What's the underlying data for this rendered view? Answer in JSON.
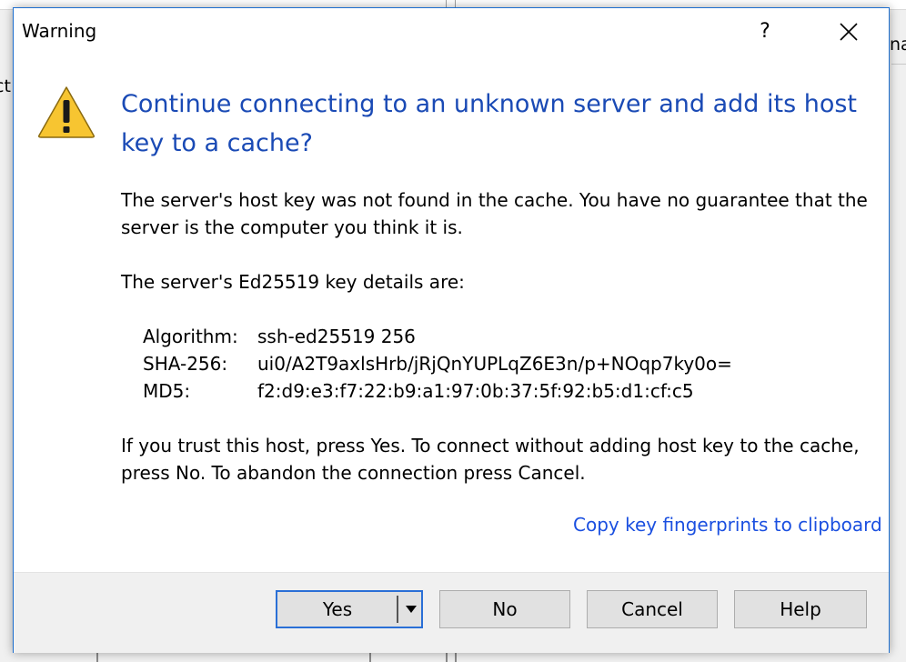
{
  "background": {
    "left_fragment": "ct",
    "right_fragment": "na"
  },
  "dialog": {
    "title": "Warning",
    "help_glyph": "?",
    "icons": {
      "warning": "warning-triangle-icon",
      "close": "close-icon",
      "dropdown": "triangle-down-icon"
    },
    "heading": "Continue connecting to an unknown server and add its host key to a cache?",
    "message1": "The server's host key was not found in the cache. You have no guarantee that the server is the computer you think it is.",
    "message2": "The server's Ed25519 key details are:",
    "details": [
      {
        "key": "Algorithm:",
        "value": "ssh-ed25519 256"
      },
      {
        "key": "SHA-256:",
        "value": "ui0/A2T9axlsHrb/jRjQnYUPLqZ6E3n/p+NOqp7ky0o="
      },
      {
        "key": "MD5:",
        "value": "f2:d9:e3:f7:22:b9:a1:97:0b:37:5f:92:b5:d1:cf:c5"
      }
    ],
    "message3": "If you trust this host, press Yes. To connect without adding host key to the cache, press No. To abandon the connection press Cancel.",
    "copy_link": "Copy key fingerprints to clipboard",
    "buttons": {
      "yes": "Yes",
      "no": "No",
      "cancel": "Cancel",
      "help": "Help"
    }
  },
  "colors": {
    "heading": "#1a4ab5",
    "link": "#1a4fe0",
    "border": "#1e6fcf",
    "warning_yellow": "#f7c531"
  }
}
